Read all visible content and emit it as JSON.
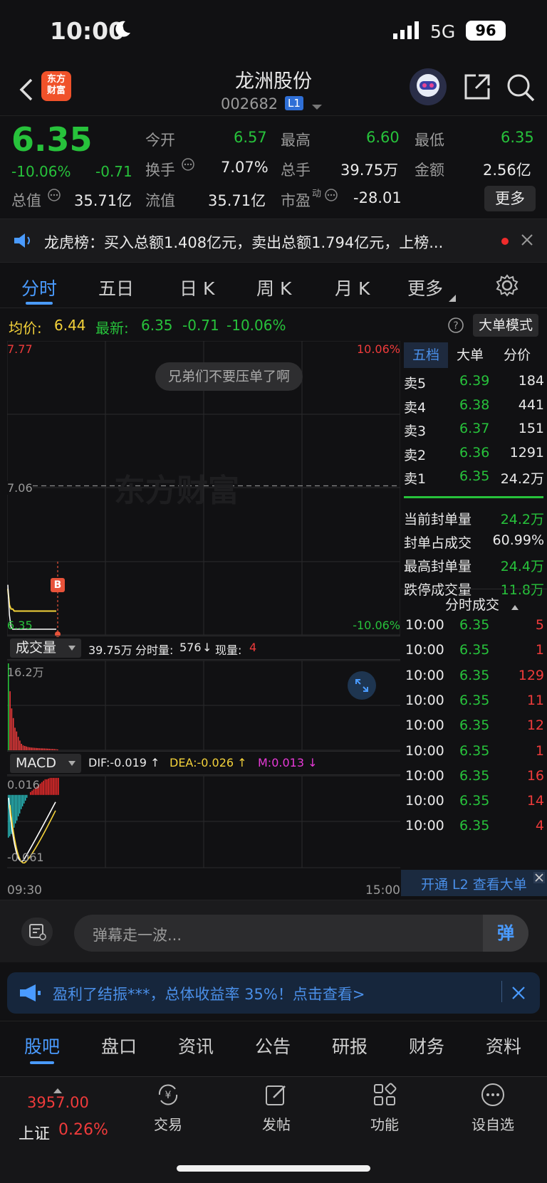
{
  "status_bar": {
    "time": "10:00",
    "signal": "5G",
    "battery": "96"
  },
  "header": {
    "logo_line1": "东方",
    "logo_line2": "财富",
    "stock_name": "龙洲股份",
    "stock_code": "002682",
    "level_badge": "L1"
  },
  "quote": {
    "price": "6.35",
    "change_pct": "-10.06%",
    "change": "-0.71",
    "open_label": "今开",
    "open": "6.57",
    "high_label": "最高",
    "high": "6.60",
    "low_label": "最低",
    "low": "6.35",
    "turnover_label": "换手",
    "turnover": "7.07%",
    "volume_label": "总手",
    "volume": "39.75万",
    "amount_label": "金额",
    "amount": "2.56亿",
    "mktcap_label": "总值",
    "mktcap": "35.71亿",
    "float_label": "流值",
    "float": "35.71亿",
    "pe_label": "市盈",
    "pe_sup": "动",
    "pe": "-28.01",
    "more_button": "更多"
  },
  "ticker": {
    "text": "龙虎榜：买入总额1.408亿元，卖出总额1.794亿元，上榜..."
  },
  "chart_tabs": [
    "分时",
    "五日",
    "日 K",
    "周 K",
    "月 K",
    "更多"
  ],
  "avg_line": {
    "avg_label": "均价:",
    "avg": "6.44",
    "latest_label": "最新:",
    "latest": "6.35",
    "change": "-0.71",
    "change_pct": "-10.06%",
    "bigorder_button": "大单模式"
  },
  "chart_labels": {
    "y_top": "7.77",
    "y_mid": "7.06",
    "y_bottom": "6.35",
    "pct_top": "10.06%",
    "pct_bottom": "-10.06%",
    "watermark": "东方财富",
    "bubble": "兄弟们不要压单了啊",
    "b_marker": "B",
    "time_start": "09:30",
    "time_end": "15:00"
  },
  "volume_panel": {
    "select": "成交量",
    "total": "39.75万",
    "fenshi_label": "分时量:",
    "fenshi": "576",
    "arrow": "↓",
    "now_label": "现量:",
    "now": "4",
    "ymax": "16.2万"
  },
  "macd_panel": {
    "select": "MACD",
    "dif": "DIF:-0.019 ↑",
    "dea": "DEA:-0.026 ↑",
    "m": "M:0.013 ↓",
    "y_top": "0.016",
    "y_bottom": "-0.061"
  },
  "chart_data": {
    "type": "line",
    "title": "",
    "x": [
      "09:30",
      "09:31",
      "09:32",
      "09:33",
      "09:34",
      "09:35",
      "09:36",
      "09:37",
      "09:38",
      "09:39",
      "09:40",
      "09:41",
      "09:42",
      "09:43",
      "09:44",
      "09:45",
      "09:46",
      "09:47",
      "09:48",
      "09:49",
      "09:50",
      "09:51",
      "09:52",
      "09:53",
      "09:54",
      "09:55",
      "09:56",
      "09:57",
      "09:58",
      "09:59",
      "10:00"
    ],
    "series": [
      {
        "name": "price",
        "values": [
          6.57,
          6.42,
          6.36,
          6.35,
          6.35,
          6.35,
          6.35,
          6.35,
          6.35,
          6.35,
          6.35,
          6.35,
          6.35,
          6.35,
          6.35,
          6.35,
          6.35,
          6.35,
          6.35,
          6.35,
          6.35,
          6.35,
          6.35,
          6.35,
          6.35,
          6.35,
          6.35,
          6.35,
          6.35,
          6.35,
          6.35
        ]
      },
      {
        "name": "avg",
        "values": [
          6.55,
          6.47,
          6.45,
          6.45,
          6.44,
          6.44,
          6.44,
          6.44,
          6.44,
          6.44,
          6.44,
          6.44,
          6.44,
          6.44,
          6.44,
          6.44,
          6.44,
          6.44,
          6.44,
          6.44,
          6.44,
          6.44,
          6.44,
          6.44,
          6.44,
          6.44,
          6.44,
          6.44,
          6.44,
          6.44,
          6.44
        ]
      }
    ],
    "ylim": [
      6.35,
      7.77
    ],
    "prev_close": 7.06,
    "volume": {
      "ylim": [
        0,
        162000
      ],
      "values": [
        162000,
        110000,
        78000,
        60000,
        42000,
        35000,
        25000,
        18000,
        12000,
        9000,
        8000,
        7000,
        6000,
        5500,
        5000,
        4800,
        4500,
        4200,
        4000,
        3800,
        3600,
        3500,
        3400,
        3200,
        3000,
        2800,
        2600,
        2400,
        2200,
        2000,
        1500
      ]
    },
    "macd": {
      "ylim": [
        -0.061,
        0.016
      ]
    }
  },
  "orderbook": {
    "tabs": [
      "五档",
      "大单",
      "分价"
    ],
    "asks": [
      {
        "label": "卖5",
        "price": "6.39",
        "vol": "184"
      },
      {
        "label": "卖4",
        "price": "6.38",
        "vol": "441"
      },
      {
        "label": "卖3",
        "price": "6.37",
        "vol": "151"
      },
      {
        "label": "卖2",
        "price": "6.36",
        "vol": "1291"
      },
      {
        "label": "卖1",
        "price": "6.35",
        "vol": "24.2万"
      }
    ],
    "stats": [
      {
        "label": "当前封单量",
        "value": "24.2万"
      },
      {
        "label": "封单占成交",
        "value": "60.99%"
      },
      {
        "label": "最高封单量",
        "value": "24.4万"
      },
      {
        "label": "跌停成交量",
        "value": "11.8万"
      }
    ]
  },
  "trades": {
    "title": "分时成交",
    "rows": [
      {
        "time": "10:00",
        "price": "6.35",
        "vol": "5"
      },
      {
        "time": "10:00",
        "price": "6.35",
        "vol": "1"
      },
      {
        "time": "10:00",
        "price": "6.35",
        "vol": "129"
      },
      {
        "time": "10:00",
        "price": "6.35",
        "vol": "11"
      },
      {
        "time": "10:00",
        "price": "6.35",
        "vol": "12"
      },
      {
        "time": "10:00",
        "price": "6.35",
        "vol": "1"
      },
      {
        "time": "10:00",
        "price": "6.35",
        "vol": "16"
      },
      {
        "time": "10:00",
        "price": "6.35",
        "vol": "14"
      },
      {
        "time": "10:00",
        "price": "6.35",
        "vol": "4"
      }
    ],
    "l2_banner": "开通 L2 查看大单"
  },
  "danmu": {
    "placeholder": "弹幕走一波...",
    "button": "弹"
  },
  "promo": {
    "text": "盈利了结振***，总体收益率 35%！点击查看>"
  },
  "sub_tabs": [
    "股吧",
    "盘口",
    "资讯",
    "公告",
    "研报",
    "财务",
    "资料"
  ],
  "bottom_nav": {
    "index_value": "3957.00",
    "index_name": "上证",
    "index_pct": "0.26%",
    "items": [
      "交易",
      "发帖",
      "功能",
      "设自选"
    ]
  },
  "colors": {
    "up": "#ef3b3b",
    "down": "#27c23b",
    "accent": "#4a9bff",
    "avg": "#f4d23a"
  }
}
